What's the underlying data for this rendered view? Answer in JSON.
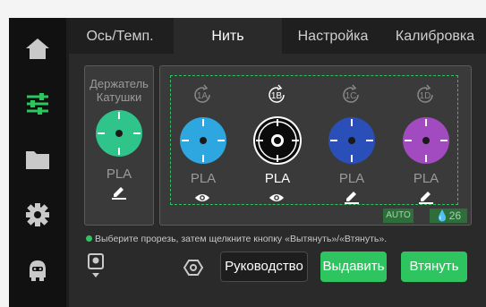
{
  "tabs": [
    {
      "label": "Ось/Темп.",
      "active": false
    },
    {
      "label": "Нить",
      "active": true
    },
    {
      "label": "Настройка",
      "active": false
    },
    {
      "label": "Калибровка",
      "active": false
    }
  ],
  "sidebar": [
    "home-icon",
    "sliders-icon",
    "folder-icon",
    "gear-icon",
    "robot-icon"
  ],
  "holder": {
    "title": "Держатель Катушки",
    "material": "PLA",
    "color": "#2ec48a",
    "status_icon": "pen-icon"
  },
  "slots": [
    {
      "badge": "1A",
      "color": "#2ea6e0",
      "material": "PLA",
      "selected": false,
      "status_icon": "eye-icon"
    },
    {
      "badge": "1B",
      "color": "#0b0b0b",
      "material": "PLA",
      "selected": true,
      "status_icon": "eye-icon"
    },
    {
      "badge": "1C",
      "color": "#2a4fb8",
      "material": "PLA",
      "selected": false,
      "status_icon": "pen-icon"
    },
    {
      "badge": "1D",
      "color": "#a24bc1",
      "material": "PLA",
      "selected": false,
      "status_icon": "pen-icon"
    }
  ],
  "auto_badge": "AUTO",
  "humidity": "26",
  "hint": "Выберите прорезь, затем щелкните кнопку «Вытянуть»/«Втянуть».",
  "buttons": {
    "guide": "Руководство",
    "extrude": "Выдавить",
    "retract": "Втянуть"
  },
  "colors": {
    "accent": "#2ec45f",
    "background": "#2a2a2a",
    "sidebar": "#111111"
  }
}
